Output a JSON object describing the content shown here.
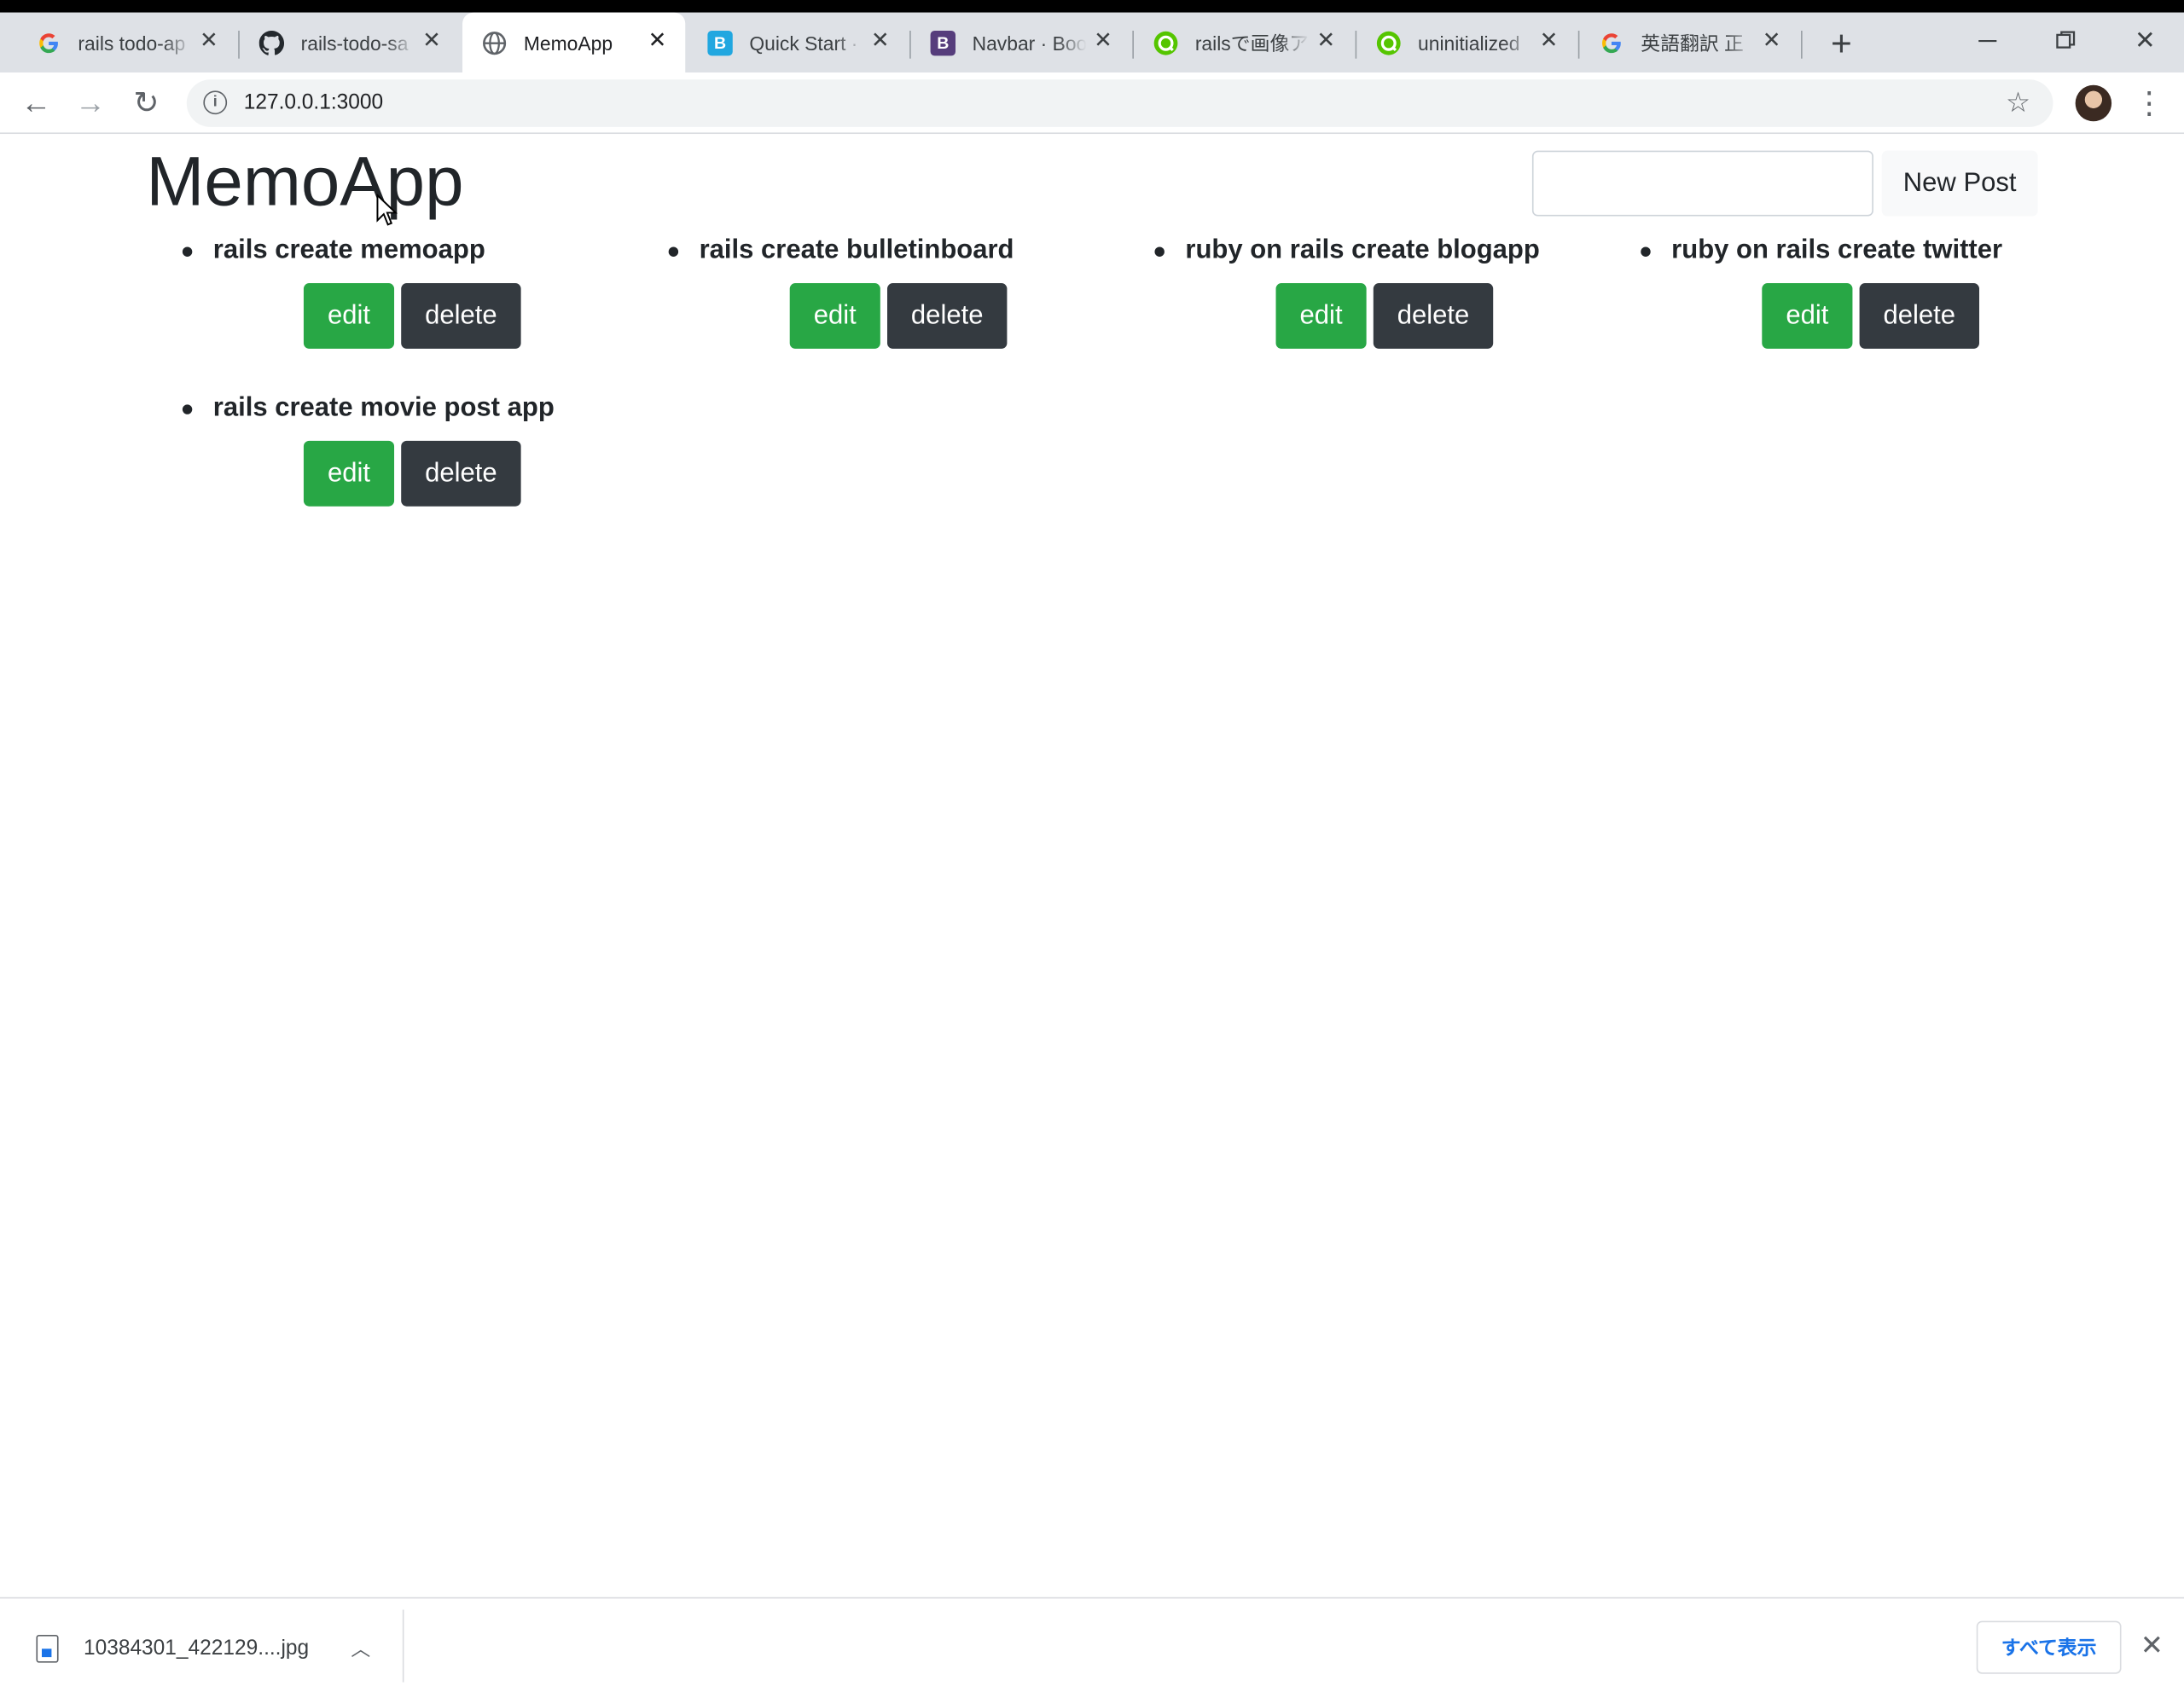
{
  "browser": {
    "tabs": [
      {
        "title": "rails todo-ap",
        "favicon": "google-icon",
        "active": false
      },
      {
        "title": "rails-todo-sa",
        "favicon": "github-icon",
        "active": false
      },
      {
        "title": "MemoApp",
        "favicon": "globe-icon",
        "active": true
      },
      {
        "title": "Quick Start ·",
        "favicon": "bootstrap-icon",
        "active": false
      },
      {
        "title": "Navbar · Boo",
        "favicon": "bootstrap-purple-icon",
        "active": false
      },
      {
        "title": "railsで画像ア",
        "favicon": "qiita-icon",
        "active": false
      },
      {
        "title": "uninitialized",
        "favicon": "qiita-icon",
        "active": false
      },
      {
        "title": "英語翻訳 正",
        "favicon": "google-icon",
        "active": false
      }
    ],
    "url": "127.0.0.1:3000"
  },
  "app": {
    "brand": "MemoApp",
    "search_placeholder": "",
    "new_post_label": "New Post",
    "edit_label": "edit",
    "delete_label": "delete",
    "memos": [
      {
        "title": "rails create memoapp"
      },
      {
        "title": "rails create bulletinboard"
      },
      {
        "title": "ruby on rails create blogapp"
      },
      {
        "title": "ruby on rails create twitter"
      },
      {
        "title": "rails create movie post app"
      }
    ]
  },
  "download_bar": {
    "file_name": "10384301_422129....jpg",
    "show_all_label": "すべて表示"
  },
  "colors": {
    "edit_button": "#28a745",
    "delete_button": "#343a40",
    "tab_strip": "#dee1e6"
  }
}
